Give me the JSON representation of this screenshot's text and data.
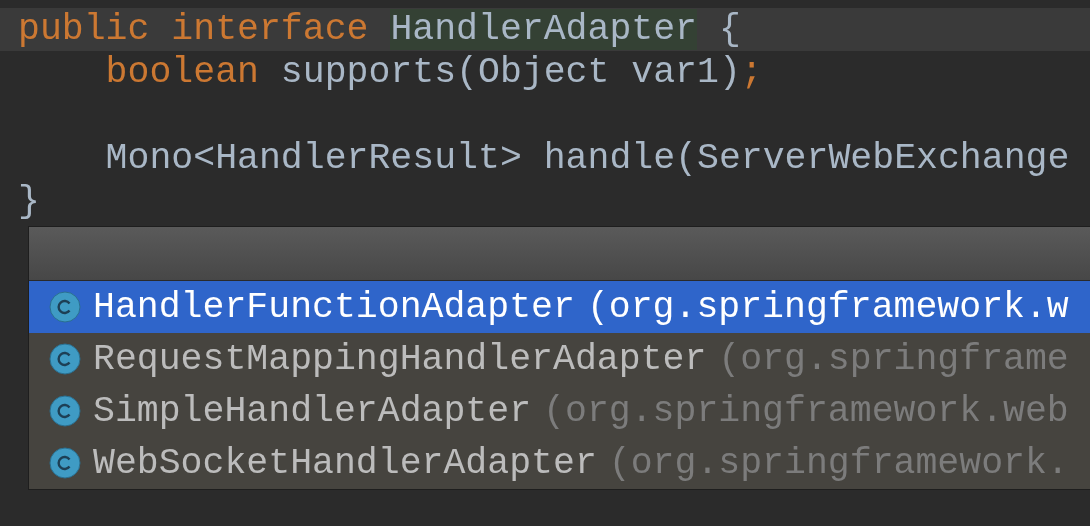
{
  "editor": {
    "lines": [
      {
        "kind": "code",
        "current": true,
        "tokens": [
          {
            "text": "public interface ",
            "kind": "keyword"
          },
          {
            "text": "HandlerAdapter",
            "kind": "usage"
          },
          {
            "text": " {",
            "kind": "plain"
          }
        ]
      },
      {
        "kind": "code",
        "current": false,
        "tokens": [
          {
            "text": "    boolean ",
            "kind": "keyword"
          },
          {
            "text": "supports(Object var1)",
            "kind": "plain"
          },
          {
            "text": ";",
            "kind": "keyword"
          }
        ]
      },
      {
        "kind": "blank"
      },
      {
        "kind": "code",
        "current": false,
        "tokens": [
          {
            "text": "    Mono<HandlerResult> handle(ServerWebExchange",
            "kind": "plain"
          }
        ]
      },
      {
        "kind": "code",
        "current": false,
        "tokens": [
          {
            "text": "}",
            "kind": "plain"
          }
        ]
      }
    ]
  },
  "completion_popup": {
    "suggestions": [
      {
        "name": "HandlerFunctionAdapter",
        "package": "(org.springframework.w",
        "selected": true
      },
      {
        "name": "RequestMappingHandlerAdapter",
        "package": "(org.springframe",
        "selected": false
      },
      {
        "name": "SimpleHandlerAdapter",
        "package": "(org.springframework.web",
        "selected": false
      },
      {
        "name": "WebSocketHandlerAdapter",
        "package": "(org.springframework.",
        "selected": false
      }
    ]
  }
}
